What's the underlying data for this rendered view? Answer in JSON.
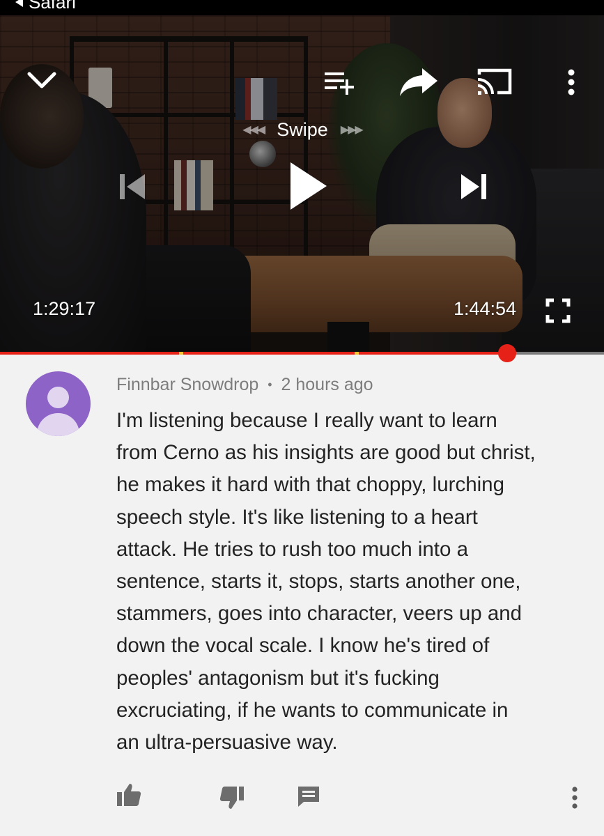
{
  "status_bar": {
    "back_label": "Safari"
  },
  "player": {
    "swipe_label": "Swipe",
    "swipe_arrows_left": "◀◀◀",
    "swipe_arrows_right": "▶▶▶",
    "current_time": "1:29:17",
    "duration": "1:44:54",
    "progress_fraction": 0.84,
    "chapter_marks": [
      0.3,
      0.59
    ],
    "icons": [
      "chevron-down-icon",
      "add-to-queue-icon",
      "share-icon",
      "cast-icon",
      "more-vert-icon",
      "skip-previous-icon",
      "play-icon",
      "skip-next-icon",
      "fullscreen-icon"
    ]
  },
  "comment": {
    "author": "Finnbar Snowdrop",
    "separator": "•",
    "timestamp": "2 hours ago",
    "lines": [
      "I'm listening because I really want to learn",
      "from Cerno as his insights are good but christ,",
      "he makes it hard with that choppy, lurching",
      "speech style. It's like listening to a heart",
      "attack. He tries to rush too much into a",
      "sentence, starts it, stops, starts another one,",
      "stammers, goes into character, veers up and",
      "down the vocal scale. I know he's tired of",
      "peoples' antagonism but it's fucking",
      "excruciating, if he wants to communicate in",
      "an ultra-persuasive way."
    ],
    "action_icons": [
      "thumb-up-icon",
      "thumb-down-icon",
      "reply-icon",
      "more-vert-icon"
    ]
  },
  "colors": {
    "accent_red": "#e62117",
    "avatar_bg": "#8e63c7",
    "chapter_mark": "#f4c430",
    "page_bg": "#f2f2f2",
    "meta_text": "#7d7d7d"
  }
}
